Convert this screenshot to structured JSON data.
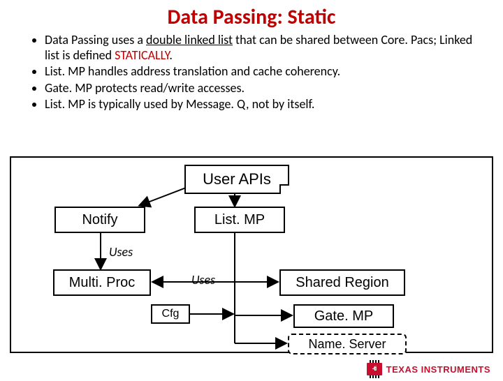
{
  "title": "Data Passing: Static",
  "bullets": [
    {
      "pre": "Data Passing uses a ",
      "u": "double linked list",
      "post": " that can be shared between Core. Pacs; Linked list is defined ",
      "static_word": "STATICALLY",
      "tail": "."
    },
    {
      "text": "List. MP handles address translation and cache coherency."
    },
    {
      "text": "Gate. MP protects read/write accesses."
    },
    {
      "text": "List. MP is typically used by Message. Q, not by itself."
    }
  ],
  "nodes": {
    "user_apis": "User APIs",
    "notify": "Notify",
    "listmp": "List. MP",
    "multiproc": "Multi. Proc",
    "shared": "Shared Region",
    "gatemp": "Gate. MP",
    "nameserver": "Name. Server",
    "cfg": "Cfg"
  },
  "labels": {
    "uses": "Uses"
  },
  "logo_text": "TEXAS INSTRUMENTS"
}
